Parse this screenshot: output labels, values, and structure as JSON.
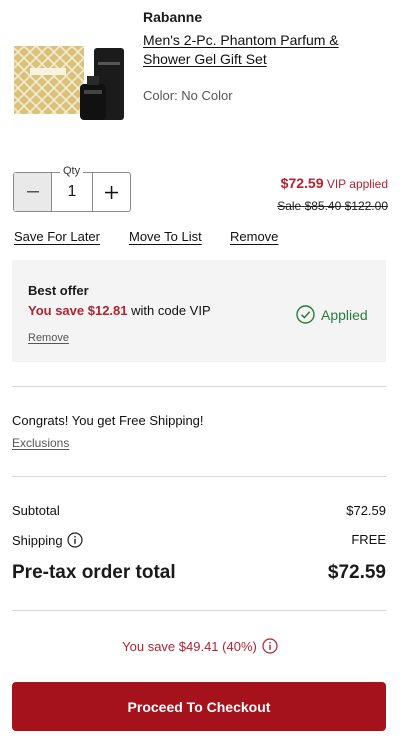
{
  "product": {
    "brand": "Rabanne",
    "name": "Men's 2-Pc. Phantom Parfum & Shower Gel Gift Set",
    "color": "Color: No Color"
  },
  "quantity": {
    "label": "Qty",
    "value": "1"
  },
  "price": {
    "current": "$72.59",
    "current_note": "VIP applied",
    "was_prefix": "Sale",
    "was_sale": "$85.40",
    "was_original": "$122.00"
  },
  "item_actions": {
    "save_for_later": "Save For Later",
    "move_to_list": "Move To List",
    "remove": "Remove"
  },
  "best_offer": {
    "title": "Best offer",
    "save_text": "You save $12.81",
    "code_text": "with code VIP",
    "remove": "Remove",
    "status": "Applied"
  },
  "shipping_notice": {
    "message": "Congrats! You get Free Shipping!",
    "exclusions": "Exclusions"
  },
  "summary": {
    "subtotal_label": "Subtotal",
    "subtotal_value": "$72.59",
    "shipping_label": "Shipping",
    "shipping_value": "FREE",
    "total_label": "Pre-tax order total",
    "total_value": "$72.59",
    "you_save": "You save $49.41 (40%)"
  },
  "checkout_button": "Proceed To Checkout",
  "colors": {
    "accent_red": "#b1232f",
    "button_red": "#a5121c",
    "applied_green": "#2a7a3b"
  }
}
